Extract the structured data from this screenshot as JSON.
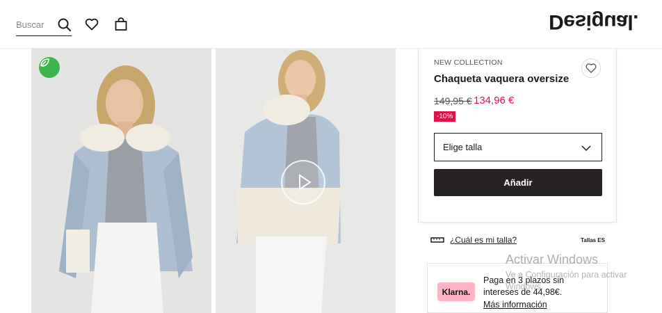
{
  "header": {
    "search_placeholder": "Buscar",
    "logo_text": "Desigual.",
    "icons": [
      "search-icon",
      "heart-icon",
      "shopping-bag-icon"
    ]
  },
  "gallery": {
    "eco_badge_icon": "leaf-icon",
    "video_icon": "play-icon"
  },
  "product": {
    "collection_label": "NEW COLLECTION",
    "title": "Chaqueta vaquera oversize",
    "price_old": "149,95 €",
    "price_new": "134,96 €",
    "discount": "-10%",
    "size_placeholder": "Elige talla",
    "add_button": "Añadir"
  },
  "size_guide": {
    "link": "¿Cuál es mi talla?",
    "sizes_region": "Tallas ES"
  },
  "klarna": {
    "logo": "Klarna.",
    "text": "Paga en 3 plazos sin intereses de 44,98€.",
    "link": "Más información"
  },
  "watermark": {
    "title": "Activar Windows",
    "subtitle": "Ve a Configuración para activar Windows."
  },
  "colors": {
    "accent_sale": "#e0114d",
    "button_dark": "#262322",
    "eco_green": "#3cb54a",
    "klarna_pink": "#ffb3c7"
  }
}
